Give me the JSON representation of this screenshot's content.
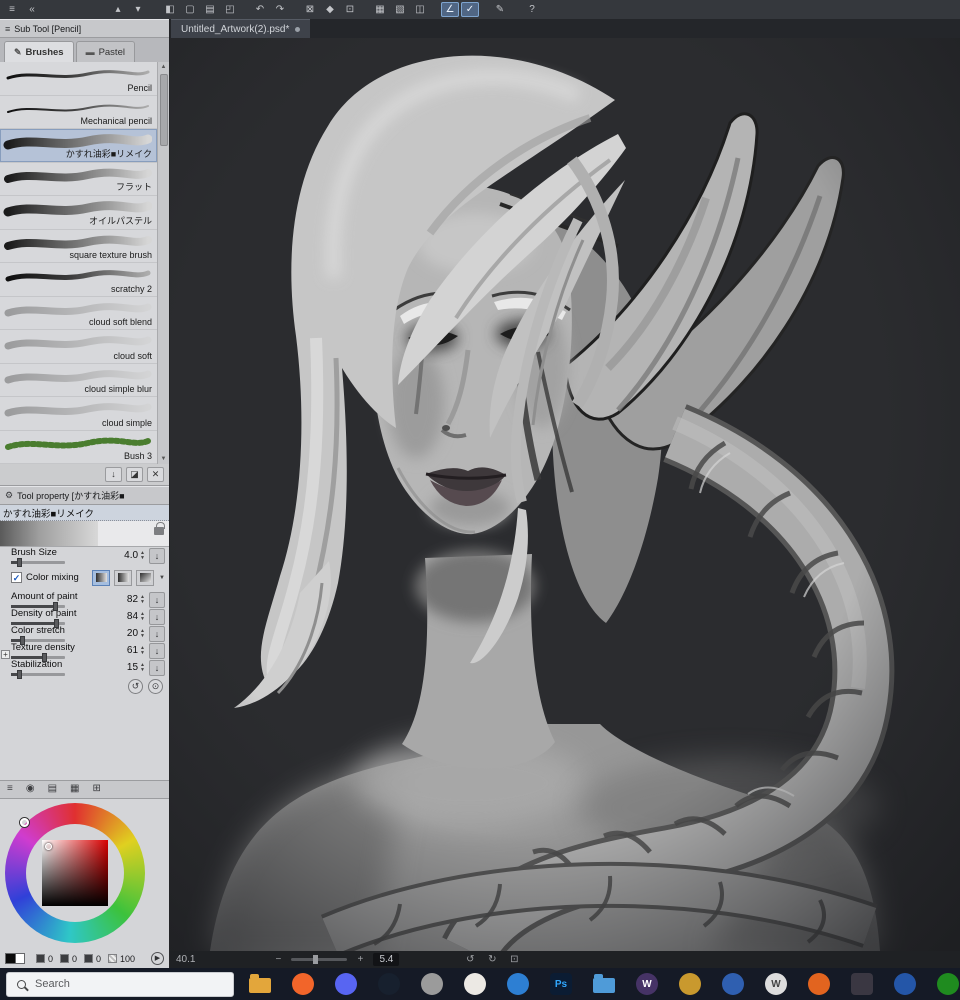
{
  "topbar": {
    "icons": [
      {
        "name": "menu-icon",
        "glyph": "≡"
      },
      {
        "name": "collapse-panel-icon",
        "glyph": "«"
      },
      {
        "sep": true,
        "w": 64
      },
      {
        "name": "scroll-up-icon",
        "glyph": "▴"
      },
      {
        "name": "scroll-down-icon",
        "glyph": "▾"
      },
      {
        "sep": true,
        "w": 10
      },
      {
        "name": "app-icon",
        "glyph": "◧"
      },
      {
        "name": "new-file-icon",
        "glyph": "▢"
      },
      {
        "name": "open-file-icon",
        "glyph": "▤"
      },
      {
        "name": "save-file-icon",
        "glyph": "◰"
      },
      {
        "sep": true,
        "w": 8
      },
      {
        "name": "undo-icon",
        "glyph": "↶"
      },
      {
        "name": "redo-icon",
        "glyph": "↷"
      },
      {
        "sep": true,
        "w": 8
      },
      {
        "name": "clear-icon",
        "glyph": "⊠"
      },
      {
        "name": "fill-icon",
        "glyph": "◆"
      },
      {
        "name": "transform-icon",
        "glyph": "⊡"
      },
      {
        "sep": true,
        "w": 8
      },
      {
        "name": "select-area-icon",
        "glyph": "▦"
      },
      {
        "name": "deselect-icon",
        "glyph": "▧"
      },
      {
        "name": "invert-select-icon",
        "glyph": "◫"
      },
      {
        "sep": true,
        "w": 8
      },
      {
        "name": "snap-ruler-icon",
        "glyph": "∠",
        "active": true
      },
      {
        "name": "snap-special-ruler-icon",
        "glyph": "✓",
        "active": true
      },
      {
        "sep": true,
        "w": 8
      },
      {
        "name": "pen-icon",
        "glyph": "✎"
      },
      {
        "sep": true,
        "w": 10
      },
      {
        "name": "help-icon",
        "glyph": "?"
      }
    ]
  },
  "doc_tab": {
    "label": "Untitled_Artwork(2).psd*"
  },
  "subtool": {
    "title": "Sub Tool [Pencil]",
    "tabs": [
      {
        "label": "Brushes",
        "active": true
      },
      {
        "label": "Pastel",
        "active": false
      }
    ],
    "brushes": [
      {
        "name": "Pencil",
        "w": 3,
        "variant": "dark"
      },
      {
        "name": "Mechanical pencil",
        "w": 2,
        "variant": "dark"
      },
      {
        "name": "かすれ油彩■リメイク",
        "w": 9,
        "variant": "texture",
        "selected": true
      },
      {
        "name": "フラット",
        "w": 8,
        "variant": "texture"
      },
      {
        "name": "オイルパステル",
        "w": 9,
        "variant": "texture"
      },
      {
        "name": "square texture brush",
        "w": 8,
        "variant": "texture"
      },
      {
        "name": "scratchy 2",
        "w": 5,
        "variant": "dark"
      },
      {
        "name": "cloud soft blend",
        "w": 7,
        "variant": "soft"
      },
      {
        "name": "cloud soft",
        "w": 7,
        "variant": "soft"
      },
      {
        "name": "cloud simple blur",
        "w": 7,
        "variant": "soft"
      },
      {
        "name": "cloud simple",
        "w": 7,
        "variant": "soft"
      },
      {
        "name": "Bush 3",
        "w": 6,
        "variant": "green"
      }
    ],
    "action_icons": [
      {
        "name": "import-brush-icon",
        "glyph": "↓"
      },
      {
        "name": "duplicate-brush-icon",
        "glyph": "◪"
      },
      {
        "name": "delete-brush-icon",
        "glyph": "✕"
      }
    ]
  },
  "tool_property": {
    "title": "Tool property [かすれ油彩■",
    "current_brush": "かすれ油彩■リメイク",
    "brush_size": {
      "label": "Brush Size",
      "value": "4.0",
      "fraction": 0.15
    },
    "color_mixing": {
      "label": "Color mixing",
      "checked": true
    },
    "rows": [
      {
        "label": "Amount of paint",
        "value": "82",
        "fraction": 0.82
      },
      {
        "label": "Density of paint",
        "value": "84",
        "fraction": 0.84
      },
      {
        "label": "Color stretch",
        "value": "20",
        "fraction": 0.2
      },
      {
        "label": "Texture density",
        "value": "61",
        "fraction": 0.61,
        "expandable": true
      },
      {
        "label": "Stabilization",
        "value": "15",
        "fraction": 0.15
      }
    ],
    "footer_icons": [
      {
        "name": "restore-defaults-icon",
        "glyph": "↺"
      },
      {
        "name": "detail-settings-icon",
        "glyph": "⊙"
      }
    ]
  },
  "color_panel": {
    "header_icons": [
      {
        "name": "menu-icon",
        "glyph": "≡"
      },
      {
        "name": "color-wheel-tab-icon",
        "glyph": "◉"
      },
      {
        "name": "color-slider-tab-icon",
        "glyph": "▤"
      },
      {
        "name": "color-set-tab-icon",
        "glyph": "▦"
      },
      {
        "name": "color-history-tab-icon",
        "glyph": "⊞"
      }
    ],
    "r": "0",
    "g": "0",
    "b": "0",
    "a": "100"
  },
  "canvas": {
    "alt": "grayscale digital painting of an elf woman with long pointed ears and a braid"
  },
  "status_bar": {
    "left_value": "40.1",
    "minus": "−",
    "plus": "+",
    "zoom_value": "5.4",
    "icons": [
      {
        "name": "rotate-left-icon",
        "glyph": "↺"
      },
      {
        "name": "rotate-right-icon",
        "glyph": "↻"
      },
      {
        "name": "fit-screen-icon",
        "glyph": "⊡"
      }
    ]
  },
  "taskbar": {
    "search_placeholder": "Search",
    "apps": [
      {
        "name": "file-explorer",
        "shape": "folder",
        "color": "#e3a63b"
      },
      {
        "name": "firefox",
        "shape": "circle",
        "color": "#f2652a"
      },
      {
        "name": "discord",
        "shape": "circle",
        "color": "#5865f2"
      },
      {
        "name": "steam",
        "shape": "circle",
        "color": "#17202e"
      },
      {
        "name": "gimp",
        "shape": "circle",
        "color": "#9b9b9b"
      },
      {
        "name": "paint-app",
        "shape": "circle",
        "color": "#ece9e4"
      },
      {
        "name": "blue-app",
        "shape": "circle",
        "color": "#2d7fd3"
      },
      {
        "name": "photoshop",
        "shape": "square",
        "color": "#0b1c33",
        "text": "Ps",
        "textColor": "#31a8ff"
      },
      {
        "name": "blue-folder",
        "shape": "folder",
        "color": "#4f9bd8"
      },
      {
        "name": "purple-w-app",
        "shape": "circle",
        "color": "#463366",
        "text": "W",
        "textColor": "#ffffff"
      },
      {
        "name": "gold-app",
        "shape": "circle",
        "color": "#c9992e"
      },
      {
        "name": "battle-net",
        "shape": "circle",
        "color": "#2f5fb0"
      },
      {
        "name": "white-w-app",
        "shape": "circle",
        "color": "#dddddd",
        "text": "W",
        "textColor": "#444444"
      },
      {
        "name": "orange-app",
        "shape": "circle",
        "color": "#e2641f"
      },
      {
        "name": "game-portrait",
        "shape": "square",
        "color": "#3a3742"
      },
      {
        "name": "blue-app-2",
        "shape": "circle",
        "color": "#2456a8"
      },
      {
        "name": "xbox",
        "shape": "circle",
        "color": "#1f8b1f"
      },
      {
        "name": "clipped-app",
        "shape": "circle",
        "color": "#c0452c"
      }
    ]
  }
}
